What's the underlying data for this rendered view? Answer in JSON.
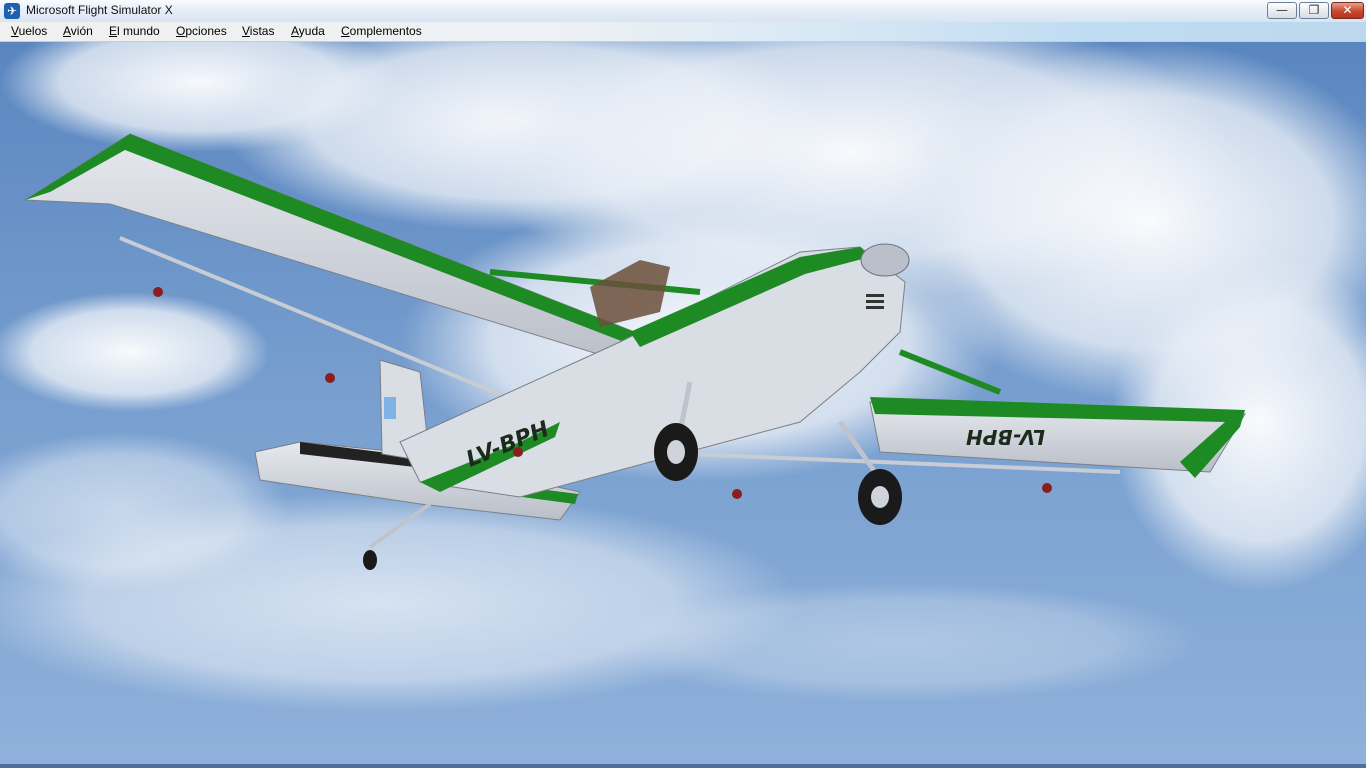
{
  "window": {
    "title": "Microsoft Flight Simulator X",
    "icon": "flight-simulator-icon",
    "controls": {
      "minimize": "—",
      "maximize": "❐",
      "close": "✕"
    }
  },
  "menu": {
    "items": [
      {
        "label": "Vuelos",
        "mnemonic": "V",
        "rest": "uelos"
      },
      {
        "label": "Avión",
        "mnemonic": "A",
        "rest": "vión"
      },
      {
        "label": "El mundo",
        "mnemonic": "E",
        "rest": "l mundo"
      },
      {
        "label": "Opciones",
        "mnemonic": "O",
        "rest": "pciones"
      },
      {
        "label": "Vistas",
        "mnemonic": "V",
        "rest": "istas"
      },
      {
        "label": "Ayuda",
        "mnemonic": "A",
        "rest": "yuda"
      },
      {
        "label": "Complementos",
        "mnemonic": "C",
        "rest": "omplementos"
      }
    ]
  },
  "scene": {
    "aircraft_registration_fuselage": "LV-BPH",
    "aircraft_registration_wing": "LV-BPH",
    "colors": {
      "sky_top": "#5f8bc4",
      "sky_bottom": "#7fa6d4",
      "cloud": "#eef2f8",
      "livery_green": "#1d8a23",
      "body_white": "#d9dde4"
    }
  }
}
